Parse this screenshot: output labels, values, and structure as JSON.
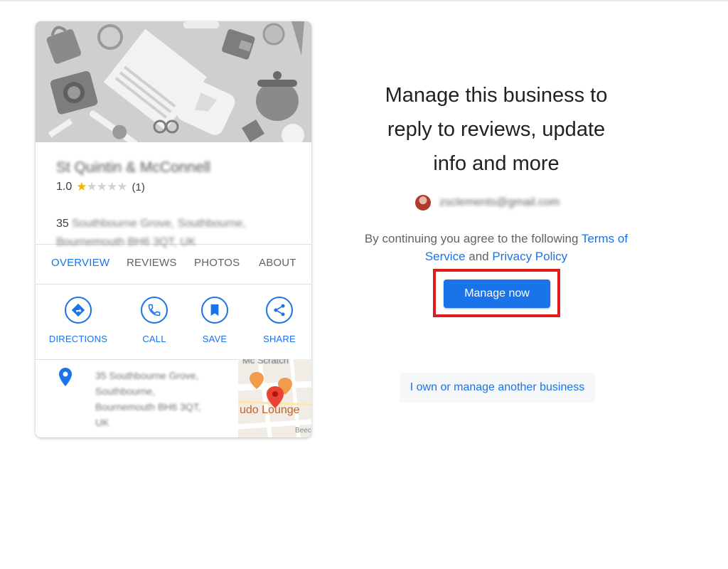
{
  "business_card": {
    "name": "St Quintin & McConnell",
    "rating": "1.0",
    "stars_filled": 1,
    "stars_total": 5,
    "review_count": "(1)",
    "address_number": "35",
    "address_line1_rest": "Southbourne Grove, Southbourne,",
    "address_line2": "Bournemouth BH6 3QT, UK",
    "tabs": [
      {
        "label": "OVERVIEW",
        "active": true
      },
      {
        "label": "REVIEWS",
        "active": false
      },
      {
        "label": "PHOTOS",
        "active": false
      },
      {
        "label": "ABOUT",
        "active": false
      }
    ],
    "actions": [
      {
        "label": "DIRECTIONS",
        "icon": "directions-icon"
      },
      {
        "label": "CALL",
        "icon": "phone-icon"
      },
      {
        "label": "SAVE",
        "icon": "bookmark-icon"
      },
      {
        "label": "SHARE",
        "icon": "share-icon"
      }
    ],
    "location_address_lines": [
      "35 Southbourne Grove,",
      "Southbourne,",
      "Bournemouth BH6 3QT,",
      "UK"
    ],
    "map_labels": {
      "street": "Mc Scratch",
      "place": "udo Lounge",
      "corner": "Beec"
    }
  },
  "panel": {
    "headline_lines": [
      "Manage this business to",
      "reply to reviews, update",
      "info and more"
    ],
    "account_email": "zsclements@gmail.com",
    "terms_prefix": "By continuing you agree to the following ",
    "terms_link": "Terms of Service",
    "terms_and": " and ",
    "privacy_link": "Privacy Policy",
    "manage_button": "Manage now",
    "other_business_button": "I own or manage another business"
  },
  "colors": {
    "accent": "#1a73e8",
    "highlight": "#e21b1b",
    "star": "#f4b400"
  }
}
